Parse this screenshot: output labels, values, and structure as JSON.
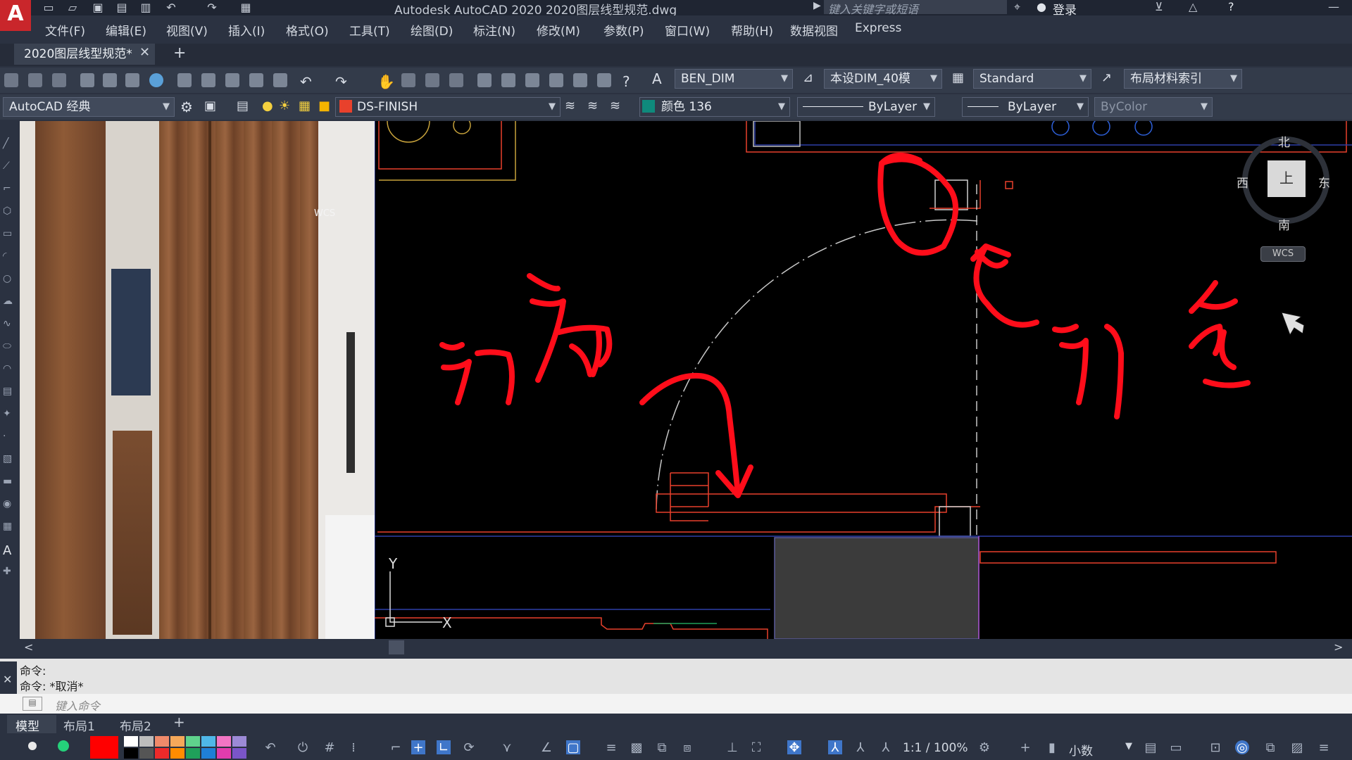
{
  "app": {
    "logo": "A",
    "title": "Autodesk AutoCAD 2020    2020图层线型规范.dwg",
    "search_placeholder": "键入关键字或短语",
    "login": "登录"
  },
  "menu": [
    "文件(F)",
    "编辑(E)",
    "视图(V)",
    "插入(I)",
    "格式(O)",
    "工具(T)",
    "绘图(D)",
    "标注(N)",
    "修改(M)",
    "参数(P)",
    "窗口(W)",
    "帮助(H)",
    "数据视图",
    "Express"
  ],
  "document_tab": {
    "label": "2020图层线型规范*",
    "close": "✕",
    "new": "+"
  },
  "toolbar1": {
    "text_style": "BEN_DIM",
    "dim_style": "本设DIM_40模",
    "table_style": "Standard",
    "mleader_style": "布局材料索引"
  },
  "toolbar2": {
    "workspace": "AutoCAD 经典",
    "layer": "DS-FINISH",
    "color": "颜色 136",
    "linetype": "ByLayer",
    "lineweight": "ByLayer",
    "plotstyle": "ByColor"
  },
  "viewcube": {
    "north": "北",
    "south": "南",
    "east": "东",
    "west": "西",
    "top": "上",
    "wcs": "WCS"
  },
  "ucs": {
    "x": "X",
    "y": "Y"
  },
  "photo_wcs": "WCS",
  "colors": {
    "accent_red": "#ff0d1a",
    "layer_red": "#e8412c",
    "color136": "#0f8a7c"
  },
  "command": {
    "history": [
      "命令:",
      "命令: *取消*"
    ],
    "placeholder": "键入命令"
  },
  "layout_tabs": [
    "模型",
    "布局1",
    "布局2"
  ],
  "status": {
    "scale": "1:1 / 100%",
    "units": "小数"
  },
  "swatches": [
    "#ff0000",
    "#ffffff",
    "#bdbdbd",
    "#f08a6a",
    "#f5a85a",
    "#5fd38c",
    "#4fb7e8",
    "#f275c4",
    "#9c8ad6",
    "#000000",
    "#555555",
    "#ee2a2a",
    "#ff8c00",
    "#1fa05a",
    "#1f7fd6",
    "#e23cad",
    "#7a55c8"
  ]
}
